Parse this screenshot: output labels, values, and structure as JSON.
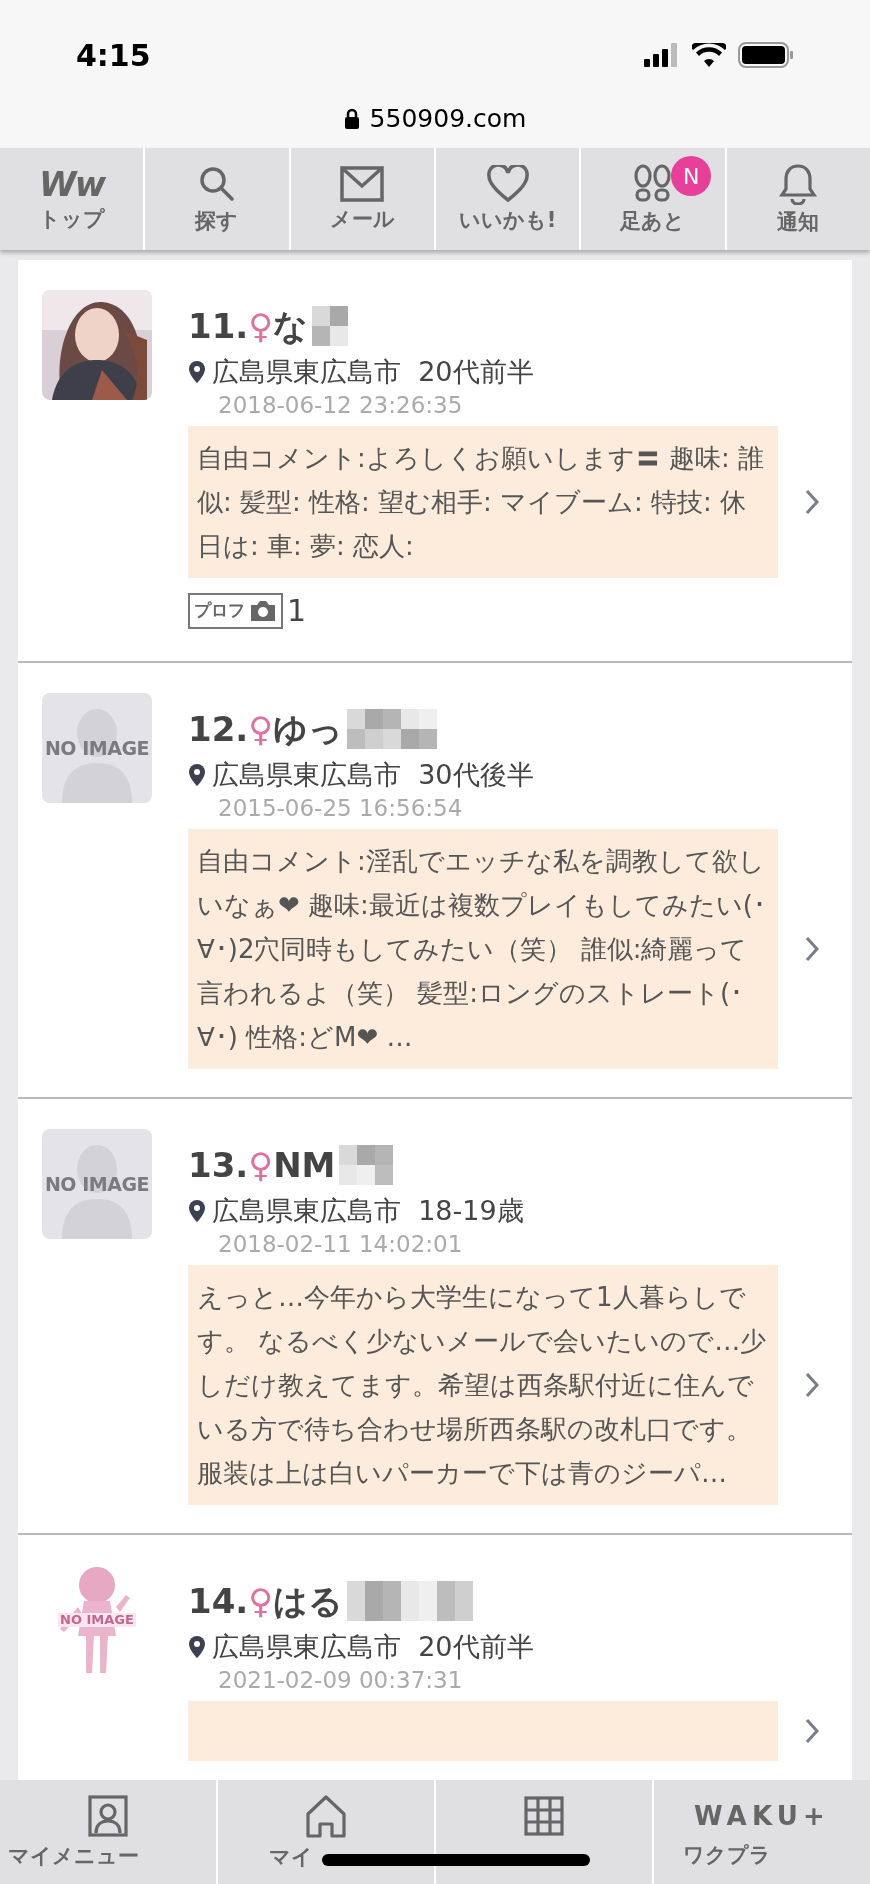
{
  "status_bar": {
    "time": "4:15"
  },
  "address_bar": {
    "url": "550909.com"
  },
  "top_nav": [
    {
      "kind": "logo",
      "logo": "Ww",
      "label": "トップ"
    },
    {
      "kind": "search",
      "label": "探す"
    },
    {
      "kind": "mail",
      "label": "メール"
    },
    {
      "kind": "heart",
      "label": "いいかも!"
    },
    {
      "kind": "footprints",
      "label": "足あと",
      "badge": "N"
    },
    {
      "kind": "bell",
      "label": "通知"
    }
  ],
  "profiles": [
    {
      "number": "11.",
      "gender": "♀",
      "name": "な",
      "location": "広島県東広島市",
      "age": "20代前半",
      "date": "2018-06-12 23:26:35",
      "comment": "自由コメント:よろしくお願いします〓 趣味: 誰似: 髪型: 性格: 望む相手: マイブーム: 特技: 休日は: 車: 夢: 恋人:",
      "photo_tag": {
        "label": "プロフ",
        "count": "1"
      }
    },
    {
      "number": "12.",
      "gender": "♀",
      "name": "ゆっ",
      "avatar": {
        "kind": "no_image",
        "text": "NO IMAGE"
      },
      "location": "広島県東広島市",
      "age": "30代後半",
      "date": "2015-06-25 16:56:54",
      "comment": "自由コメント:淫乱でエッチな私を調教して欲しいなぁ❤ 趣味:最近は複数プレイもしてみたい(･∀･)2穴同時もしてみたい（笑） 誰似:綺麗って言われるよ（笑） 髪型:ロングのストレート(･∀･) 性格:どM❤ …"
    },
    {
      "number": "13.",
      "gender": "♀",
      "name": "NM",
      "avatar": {
        "kind": "no_image",
        "text": "NO IMAGE"
      },
      "location": "広島県東広島市",
      "age": "18-19歳",
      "date": "2018-02-11 14:02:01",
      "comment": "えっと…今年から大学生になって1人暮らしです。 なるべく少ないメールで会いたいので…少しだけ教えてます。希望は西条駅付近に住んでいる方で待ち合わせ場所西条駅の改札口です。服装は上は白いパーカーで下は青のジーパ…"
    },
    {
      "number": "14.",
      "gender": "♀",
      "name": "はる",
      "avatar": {
        "kind": "figure",
        "text": "NO IMAGE"
      },
      "location": "広島県東広島市",
      "age": "20代前半",
      "date": "2021-02-09 00:37:31"
    }
  ],
  "bottom_nav": [
    {
      "kind": "person",
      "label": "マイメニュー"
    },
    {
      "kind": "home",
      "label": "マイ"
    },
    {
      "kind": "grid"
    },
    {
      "kind": "logo",
      "logo": "WAKU+",
      "label": "ワクプラ"
    }
  ]
}
